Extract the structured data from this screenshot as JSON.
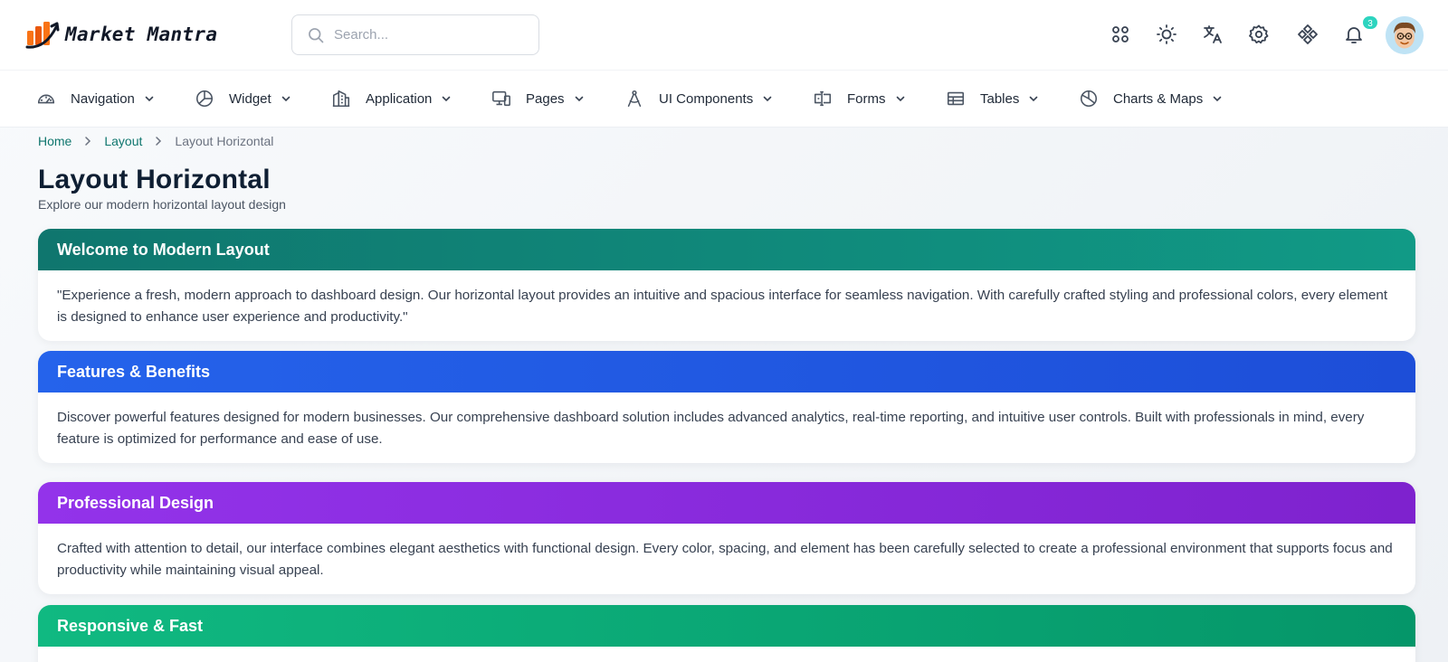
{
  "brand": {
    "name": "Market Mantra",
    "logo_icon": "chart-arrow-logo",
    "accent": "#f97316"
  },
  "search": {
    "placeholder": "Search..."
  },
  "header_icons": [
    {
      "name": "apps-grid-icon"
    },
    {
      "name": "sun-icon"
    },
    {
      "name": "translate-icon"
    },
    {
      "name": "gear-icon"
    },
    {
      "name": "diamond-grid-icon"
    },
    {
      "name": "bell-icon",
      "badge": "3"
    }
  ],
  "nav": {
    "items": [
      {
        "label": "Navigation",
        "icon": "gauge-icon"
      },
      {
        "label": "Widget",
        "icon": "pie-chart-icon"
      },
      {
        "label": "Application",
        "icon": "buildings-icon"
      },
      {
        "label": "Pages",
        "icon": "devices-icon"
      },
      {
        "label": "UI Components",
        "icon": "compass-icon"
      },
      {
        "label": "Forms",
        "icon": "form-input-icon"
      },
      {
        "label": "Tables",
        "icon": "table-icon"
      },
      {
        "label": "Charts & Maps",
        "icon": "chart-pie-icon"
      }
    ]
  },
  "breadcrumb": {
    "home": "Home",
    "layout": "Layout",
    "current": "Layout Horizontal"
  },
  "page": {
    "title": "Layout Horizontal",
    "subtitle": "Explore our modern horizontal layout design"
  },
  "cards": [
    {
      "title": "Welcome to Modern Layout",
      "body": "\"Experience a fresh, modern approach to dashboard design. Our horizontal layout provides an intuitive and spacious interface for seamless navigation. With carefully crafted styling and professional colors, every element is designed to enhance user experience and productivity.\"",
      "color": "#0f766e"
    },
    {
      "title": "Features & Benefits",
      "body": "Discover powerful features designed for modern businesses. Our comprehensive dashboard solution includes advanced analytics, real-time reporting, and intuitive user controls. Built with professionals in mind, every feature is optimized for performance and ease of use.",
      "color": "#2563eb"
    },
    {
      "title": "Professional Design",
      "body": "Crafted with attention to detail, our interface combines elegant aesthetics with functional design. Every color, spacing, and element has been carefully selected to create a professional environment that supports focus and productivity while maintaining visual appeal.",
      "color": "#9333ea"
    },
    {
      "title": "Responsive & Fast",
      "body": "",
      "color": "#10b981"
    }
  ]
}
